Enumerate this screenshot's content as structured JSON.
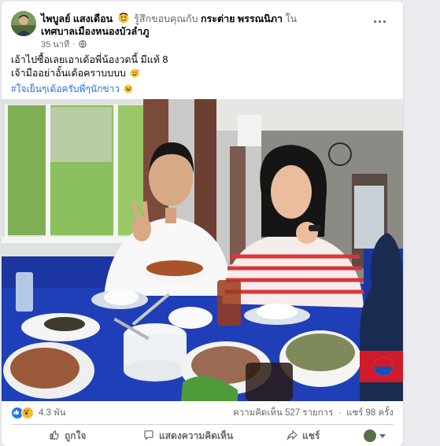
{
  "post": {
    "author": "ไพบูลย์ แสงเดือน",
    "feeling": "รู้สึกขอบคุณกับ",
    "tagged_person": "กระต่าย พรรณนิภา",
    "location_prefix": "ใน",
    "location": "เทศบาลเมืองหนองบัวลำภู",
    "time": "35 นาที",
    "line1": "เอ้าไปซื้อเลยเอาเด้อพี่น้องวดนี้ มีแท้ 8",
    "line2": "เจ้ามืออย่าอั้นเด้อคราบบบบ",
    "hashtag": "#ใจเย็นๆเด้อครับพี่ๆนักข่าว",
    "reaction_count": "4.3 พัน",
    "comments": "ความคิดเห็น 527 รายการ",
    "shares": "แชร์ 98 ครั้ง",
    "actions": {
      "like": "ถูกใจ",
      "comment": "แสดงความคิดเห็น",
      "share": "แชร์"
    }
  },
  "icons": {
    "more": "more-options-icon",
    "globe": "globe-icon",
    "like": "like-icon",
    "comment": "comment-icon",
    "share": "share-icon"
  },
  "colors": {
    "accent": "#1877f2",
    "link": "#216fdb",
    "muted": "#65676b"
  }
}
